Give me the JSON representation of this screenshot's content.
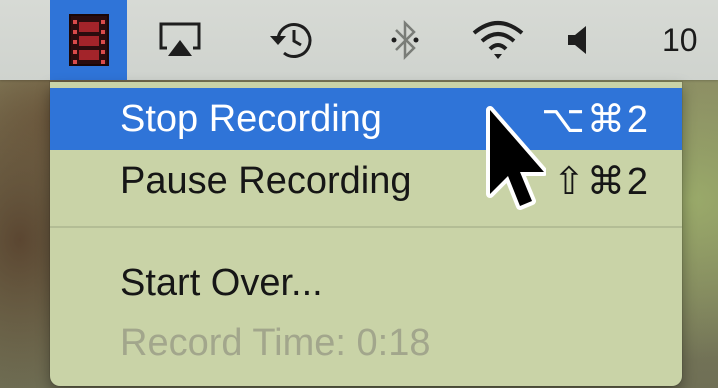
{
  "menubar": {
    "app_icon": "film-strip-icon",
    "status_icons": [
      "airplay-icon",
      "time-machine-icon",
      "bluetooth-icon",
      "wifi-icon",
      "volume-icon"
    ],
    "clock_text": "10"
  },
  "menu": {
    "items": [
      {
        "label": "Stop Recording",
        "shortcut": "⌥⌘2",
        "highlighted": true,
        "enabled": true
      },
      {
        "label": "Pause Recording",
        "shortcut": "⇧⌘2",
        "highlighted": false,
        "enabled": true
      },
      {
        "label": "Start Over...",
        "shortcut": "",
        "highlighted": false,
        "enabled": true
      },
      {
        "label": "Record Time: 0:18",
        "shortcut": "",
        "highlighted": false,
        "enabled": false
      }
    ]
  },
  "colors": {
    "highlight": "#2f74d8",
    "menu_background": "#c9d3a7",
    "menubar_background": "#d7dad5",
    "disabled_text": "#a2a68c"
  },
  "cursor": "arrow-cursor-icon"
}
